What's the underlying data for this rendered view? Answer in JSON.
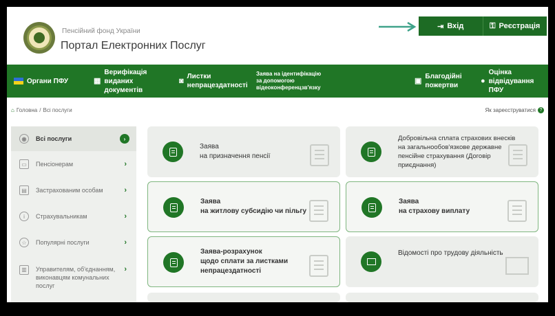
{
  "header": {
    "org_name": "Пенсійний фонд України",
    "portal_name": "Портал Електронних Послуг",
    "login_label": "Вхід",
    "register_label": "Реєстрація"
  },
  "nav": {
    "orgs": "Органи ПФУ",
    "verif_1": "Верифікація",
    "verif_2": "виданих документів",
    "sick_1": "Листки",
    "sick_2": "непрацездатності",
    "ident_1": "Заява на ідентифікацію",
    "ident_2": "за допомогою",
    "ident_3": "відеоконференцзв'язку",
    "charity_1": "Благодійні",
    "charity_2": "пожертви",
    "rate_1": "Оцінка",
    "rate_2": "відвідування ПФУ"
  },
  "breadcrumb": {
    "home": "Головна",
    "sep": "/",
    "current": "Всі послуги"
  },
  "how_register": "Як зареєструватися",
  "sidebar": {
    "items": [
      {
        "label": "Всі послуги"
      },
      {
        "label": "Пенсіонерам"
      },
      {
        "label": "Застрахованим особам"
      },
      {
        "label": "Страхувальникам"
      },
      {
        "label": "Популярні послуги"
      },
      {
        "label_1": "Управителям, об'єднанням,",
        "label_2": "виконавцям комунальних",
        "label_3": "послуг"
      }
    ]
  },
  "cards": [
    {
      "l1": "Заява",
      "l2": "на призначення пенсії"
    },
    {
      "l1": "Добровільна сплата страхових внесків",
      "l2": "на загальнообов'язкове державне",
      "l3": "пенсійне страхування (Договір",
      "l4": "приєднання)"
    },
    {
      "l1": "Заява",
      "l2": "на житлову субсидію чи пільгу"
    },
    {
      "l1": "Заява",
      "l2": "на страхову виплату"
    },
    {
      "l1": "Заява-розрахунок",
      "l2": "щодо сплати за листками",
      "l3": "непрацездатності"
    },
    {
      "l1": "Відомості про трудову діяльність"
    }
  ],
  "colors": {
    "brand_green": "#207626",
    "dark_green": "#1d6b24",
    "arrow_teal": "#3fa38a"
  },
  "icons": [
    "login-icon",
    "key-icon",
    "flag-icon",
    "verify-icon",
    "camera-icon",
    "gift-icon",
    "chat-icon",
    "home-icon",
    "question-icon",
    "document-icon",
    "envelope-icon"
  ]
}
